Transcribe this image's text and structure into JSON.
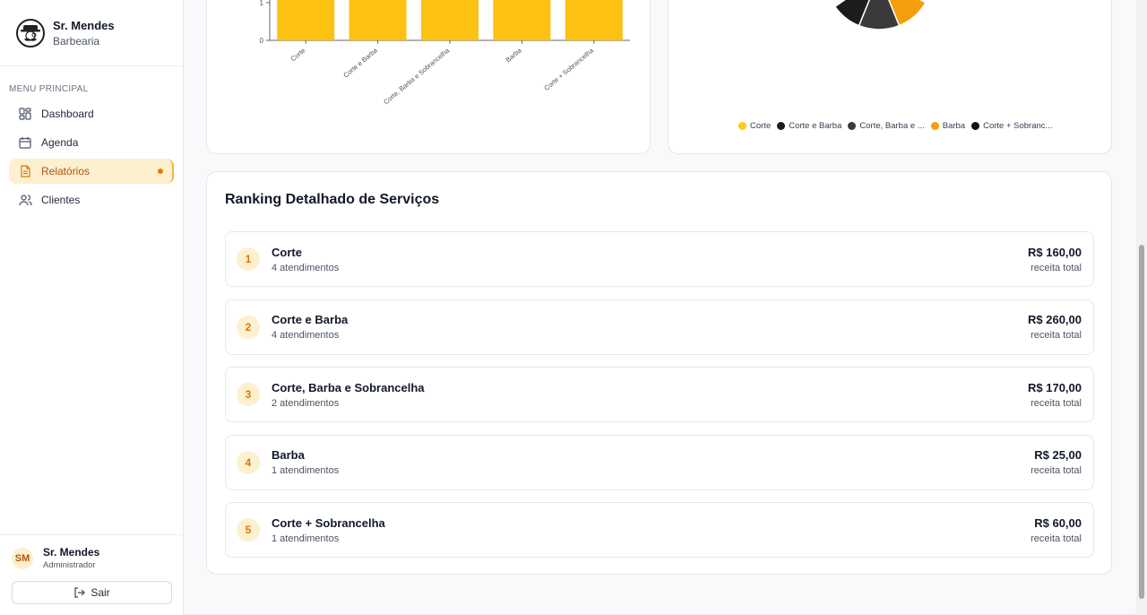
{
  "brand": {
    "name": "Sr. Mendes",
    "subtitle": "Barbearia"
  },
  "menu": {
    "title": "MENU PRINCIPAL",
    "items": [
      {
        "label": "Dashboard",
        "icon": "dashboard-icon"
      },
      {
        "label": "Agenda",
        "icon": "calendar-icon"
      },
      {
        "label": "Relatórios",
        "icon": "report-icon",
        "active": true
      },
      {
        "label": "Clientes",
        "icon": "users-icon"
      }
    ]
  },
  "user": {
    "initials": "SM",
    "name": "Sr. Mendes",
    "role": "Administrador"
  },
  "logout": {
    "label": "Sair"
  },
  "colors": {
    "accent": "#fbbf24",
    "accent_dark": "#d97706",
    "active_bg": "#fdf0cf"
  },
  "chart_data": [
    {
      "type": "bar",
      "categories": [
        "Corte",
        "Corte e Barba",
        "Corte, Barba e Sobrancelha",
        "Barba",
        "Corte + Sobrancelha"
      ],
      "values": [
        1.0,
        1.0,
        1.0,
        0.95,
        0.95
      ],
      "yticks": [
        "0",
        "1"
      ],
      "ylim": [
        0,
        1
      ],
      "color": "#fcc111"
    },
    {
      "type": "pie",
      "labels": [
        "Corte",
        "Corte e Barba",
        "Corte, Barba e ...",
        "Barba",
        "Corte + Sobranc..."
      ],
      "colors": [
        "#facc15",
        "#1c1c1c",
        "#3a3a3a",
        "#f59e0b",
        "#111111"
      ],
      "legend": "bottom"
    }
  ],
  "ranking": {
    "title": "Ranking Detalhado de Serviços",
    "items": [
      {
        "rank": "1",
        "name": "Corte",
        "count": "4 atendimentos",
        "value": "R$ 160,00",
        "label": "receita total"
      },
      {
        "rank": "2",
        "name": "Corte e Barba",
        "count": "4 atendimentos",
        "value": "R$ 260,00",
        "label": "receita total"
      },
      {
        "rank": "3",
        "name": "Corte, Barba e Sobrancelha",
        "count": "2 atendimentos",
        "value": "R$ 170,00",
        "label": "receita total"
      },
      {
        "rank": "4",
        "name": "Barba",
        "count": "1 atendimentos",
        "value": "R$ 25,00",
        "label": "receita total"
      },
      {
        "rank": "5",
        "name": "Corte + Sobrancelha",
        "count": "1 atendimentos",
        "value": "R$ 60,00",
        "label": "receita total"
      }
    ]
  }
}
